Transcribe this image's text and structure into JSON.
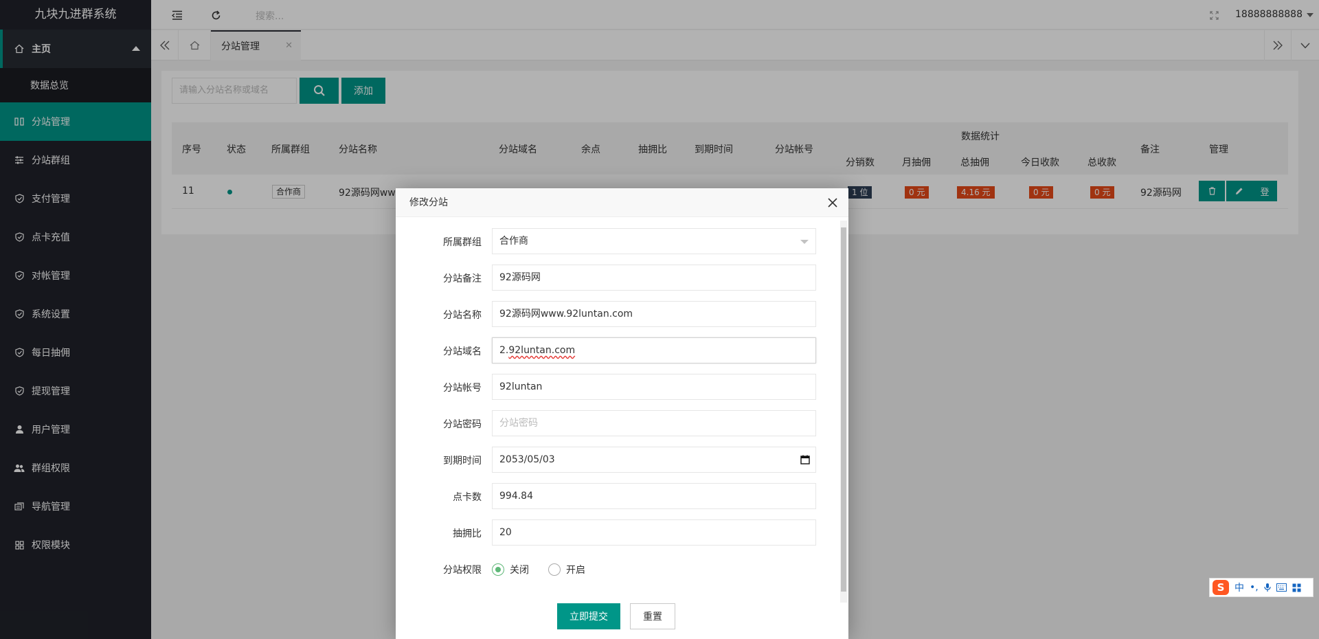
{
  "app": {
    "title": "九块九进群系统"
  },
  "sidebar": {
    "home": "主页",
    "home_sub": "数据总览",
    "items": [
      {
        "label": "分站管理",
        "icon": "columns-icon"
      },
      {
        "label": "分站群组",
        "icon": "sliders-icon"
      },
      {
        "label": "支付管理",
        "icon": "shield-icon"
      },
      {
        "label": "点卡充值",
        "icon": "shield-icon"
      },
      {
        "label": "对帐管理",
        "icon": "shield-icon"
      },
      {
        "label": "系统设置",
        "icon": "shield-icon"
      },
      {
        "label": "每日抽佣",
        "icon": "shield-icon"
      },
      {
        "label": "提现管理",
        "icon": "shield-icon"
      },
      {
        "label": "用户管理",
        "icon": "user-icon"
      },
      {
        "label": "群组权限",
        "icon": "group-icon"
      },
      {
        "label": "导航管理",
        "icon": "nav-icon"
      },
      {
        "label": "权限模块",
        "icon": "grid-icon"
      }
    ]
  },
  "header": {
    "search_placeholder": "搜索...",
    "username": "18888888888"
  },
  "tabs": {
    "active": "分站管理"
  },
  "toolbar": {
    "search_placeholder": "请输入分站名称或域名",
    "add_label": "添加"
  },
  "table": {
    "headers": {
      "seq": "序号",
      "status": "状态",
      "group": "所属群组",
      "name": "分站名称",
      "domain": "分站域名",
      "balance": "余点",
      "ratio": "抽拥比",
      "expire": "到期时间",
      "account": "分站帐号",
      "stats": "数据统计",
      "sub_count": "分销数",
      "month_comm": "月抽佣",
      "total_comm": "总抽佣",
      "today_income": "今日收款",
      "total_income": "总收款",
      "remark": "备注",
      "manage": "管理"
    },
    "row": {
      "seq": "11",
      "group": "合作商",
      "name": "92源码网www",
      "sub_count": "1 位",
      "month_comm": "0 元",
      "total_comm": "4.16 元",
      "today_income": "0 元",
      "total_income": "0 元",
      "remark": "92源码网",
      "login_label": "登"
    }
  },
  "modal": {
    "title": "修改分站",
    "fields": {
      "group_label": "所属群组",
      "group_value": "合作商",
      "remark_label": "分站备注",
      "remark_value": "92源码网",
      "name_label": "分站名称",
      "name_value": "92源码网www.92luntan.com",
      "domain_label": "分站域名",
      "domain_prefix": "2.",
      "domain_value": "92luntan.com",
      "account_label": "分站帐号",
      "account_value": "92luntan",
      "password_label": "分站密码",
      "password_placeholder": "分站密码",
      "expire_label": "到期时间",
      "expire_value": "2053/05/03",
      "points_label": "点卡数",
      "points_value": "994.84",
      "ratio_label": "抽拥比",
      "ratio_value": "20",
      "perm_label": "分站权限",
      "perm_off": "关闭",
      "perm_on": "开启"
    },
    "submit_label": "立即提交",
    "reset_label": "重置"
  },
  "ime": {
    "lang": "中",
    "punct": "•,"
  },
  "colors": {
    "accent": "#009688",
    "sidebar": "#20222a",
    "badge_dark": "#2f4056",
    "badge_orange": "#e64a19",
    "radio_on": "#5fb878"
  }
}
